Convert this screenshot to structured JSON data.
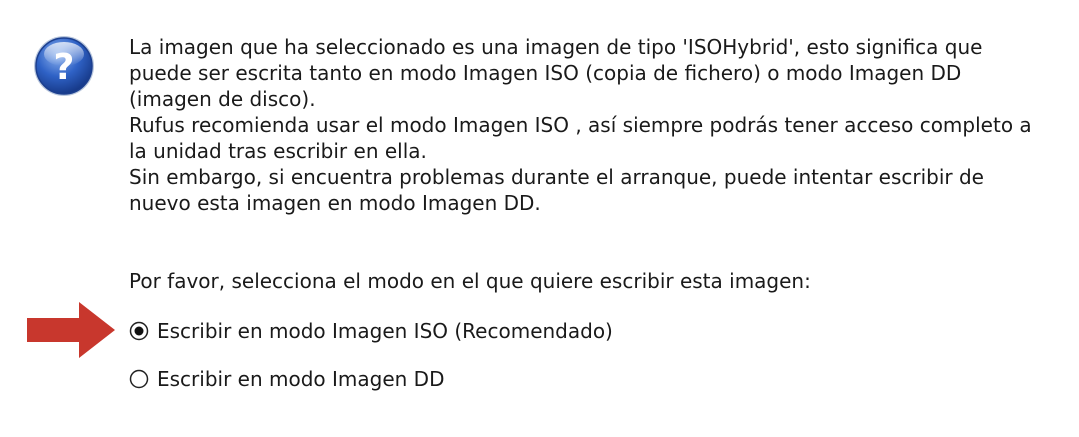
{
  "dialog": {
    "icon": "question-icon",
    "message_lines": [
      "La imagen que ha seleccionado es una imagen de tipo 'ISOHybrid', esto significa que",
      "puede ser escrita tanto en modo Imagen ISO (copia de fichero) o modo Imagen DD",
      "(imagen de disco).",
      "Rufus recomienda usar el modo Imagen ISO , así siempre podrás tener acceso completo a",
      "la unidad tras escribir en ella.",
      "Sin embargo, si encuentra problemas durante el arranque, puede intentar escribir de",
      "nuevo esta imagen en modo Imagen DD."
    ],
    "prompt": "Por favor, selecciona el modo en el que quiere escribir esta imagen:",
    "options": [
      {
        "label": "Escribir en modo Imagen ISO (Recomendado)",
        "selected": true
      },
      {
        "label": "Escribir en modo Imagen DD",
        "selected": false
      }
    ]
  },
  "annotation": {
    "arrow_icon": "red-arrow-icon",
    "arrow_color": "#c8372d"
  },
  "colors": {
    "icon_blue": "#2a5fbf",
    "text": "#1a1a1a"
  }
}
